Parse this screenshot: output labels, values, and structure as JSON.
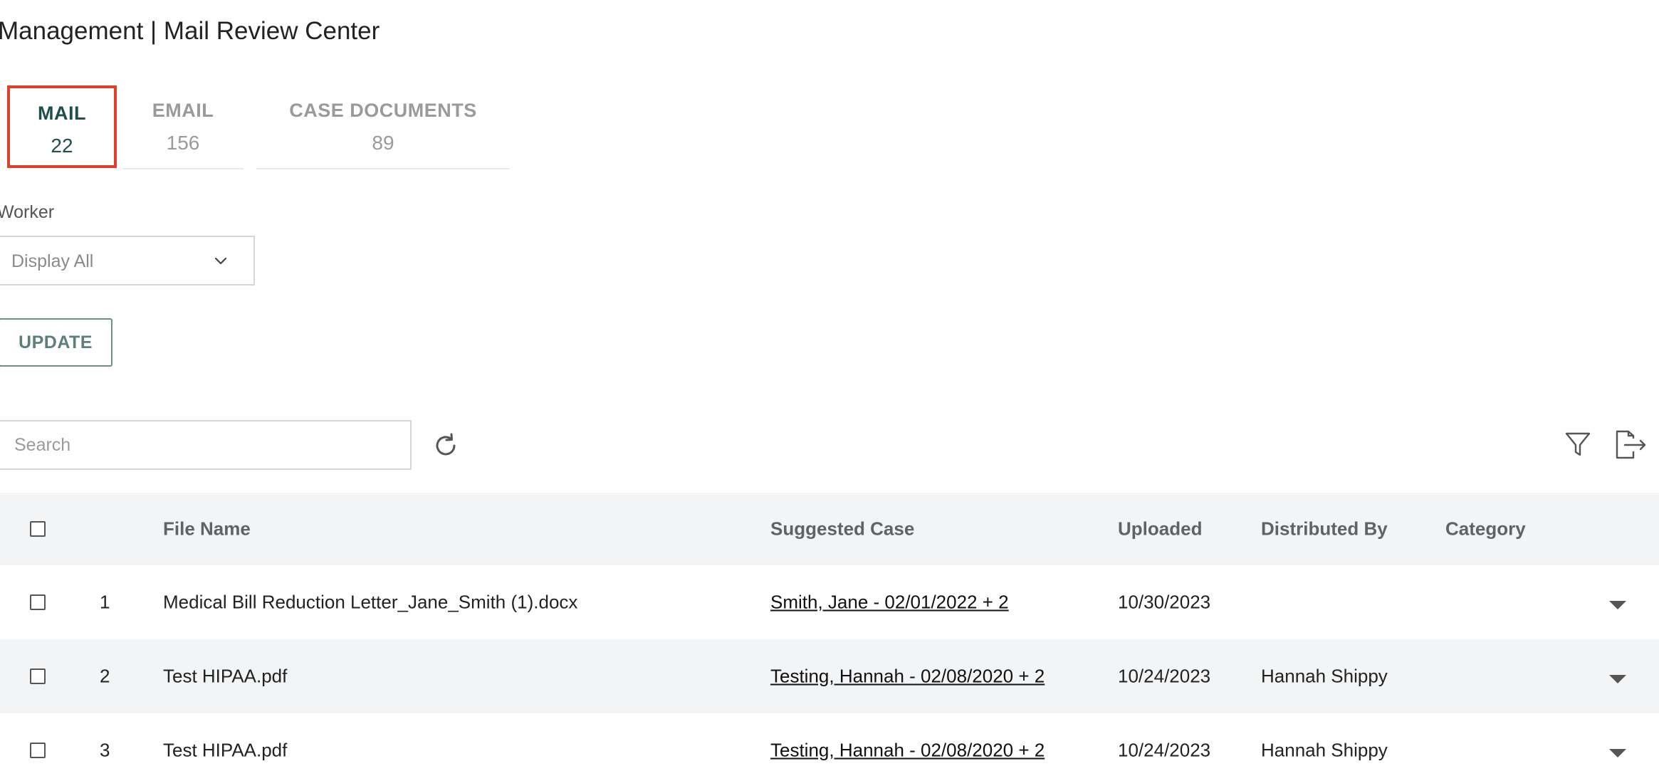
{
  "page": {
    "title": "Management | Mail Review Center"
  },
  "tabs": [
    {
      "label": "MAIL",
      "count": "22",
      "active": true
    },
    {
      "label": "EMAIL",
      "count": "156",
      "active": false
    },
    {
      "label": "CASE DOCUMENTS",
      "count": "89",
      "active": false
    }
  ],
  "filters": {
    "worker_label": "Worker",
    "worker_value": "Display All",
    "update_label": "UPDATE"
  },
  "toolbar": {
    "search_placeholder": "Search",
    "icons": [
      "refresh-icon",
      "filter-icon",
      "export-icon"
    ]
  },
  "table": {
    "headers": {
      "file_name": "File Name",
      "suggested_case": "Suggested Case",
      "uploaded": "Uploaded",
      "distributed_by": "Distributed By",
      "category": "Category"
    },
    "rows": [
      {
        "num": "1",
        "file_name": "Medical Bill Reduction Letter_Jane_Smith (1).docx",
        "suggested_case": "Smith, Jane - 02/01/2022 + 2",
        "uploaded": "10/30/2023",
        "distributed_by": "",
        "category": ""
      },
      {
        "num": "2",
        "file_name": "Test HIPAA.pdf",
        "suggested_case": "Testing, Hannah - 02/08/2020 + 2",
        "uploaded": "10/24/2023",
        "distributed_by": "Hannah Shippy",
        "category": ""
      },
      {
        "num": "3",
        "file_name": "Test HIPAA.pdf",
        "suggested_case": "Testing, Hannah - 02/08/2020 + 2",
        "uploaded": "10/24/2023",
        "distributed_by": "Hannah Shippy",
        "category": ""
      }
    ]
  },
  "colors": {
    "active_tab": "#1f4f4b",
    "highlight_border": "#e0402b",
    "update_button": "#5a807c"
  }
}
